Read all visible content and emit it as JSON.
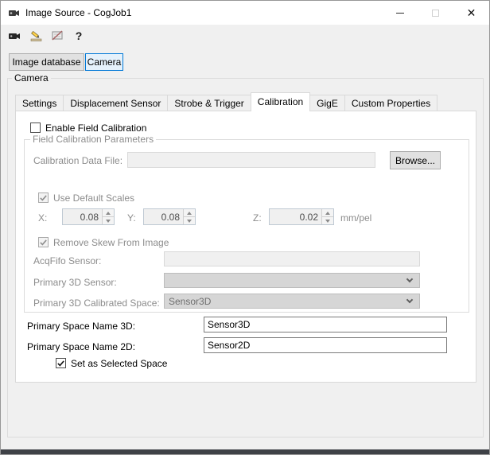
{
  "window": {
    "title": "Image Source - CogJob1"
  },
  "icons": {
    "close": "✕",
    "help": "?"
  },
  "colors": {
    "accent": "#0078d7"
  },
  "source_selector": {
    "image_database_label": "Image database",
    "camera_label": "Camera"
  },
  "camera_group": {
    "label": "Camera",
    "tabs": [
      {
        "label": "Settings",
        "active": false
      },
      {
        "label": "Displacement Sensor",
        "active": false
      },
      {
        "label": "Strobe & Trigger",
        "active": false
      },
      {
        "label": "Calibration",
        "active": true
      },
      {
        "label": "GigE",
        "active": false
      },
      {
        "label": "Custom Properties",
        "active": false
      }
    ]
  },
  "calibration": {
    "enable_field_calibration": {
      "label": "Enable Field Calibration",
      "checked": false
    },
    "field_params": {
      "group_label": "Field Calibration Parameters",
      "calibration_data_file": {
        "label": "Calibration Data File:",
        "value": "",
        "browse_label": "Browse..."
      },
      "use_default_scales": {
        "label": "Use Default Scales",
        "checked": true
      },
      "scales": {
        "x_label": "X:",
        "x_value": "0.08",
        "y_label": "Y:",
        "y_value": "0.08",
        "z_label": "Z:",
        "z_value": "0.02",
        "unit": "mm/pel"
      },
      "remove_skew": {
        "label": "Remove Skew From Image",
        "checked": true
      },
      "acqfifo_sensor": {
        "label": "AcqFifo Sensor:",
        "value": ""
      },
      "primary_3d_sensor": {
        "label": "Primary 3D Sensor:",
        "value": ""
      },
      "primary_3d_calibrated_space": {
        "label": "Primary 3D Calibrated Space:",
        "value": "Sensor3D"
      }
    },
    "primary_space_name_3d": {
      "label": "Primary Space Name 3D:",
      "value": "Sensor3D"
    },
    "primary_space_name_2d": {
      "label": "Primary Space Name 2D:",
      "value": "Sensor2D"
    },
    "set_as_selected_space": {
      "label": "Set as Selected Space",
      "checked": true
    }
  }
}
